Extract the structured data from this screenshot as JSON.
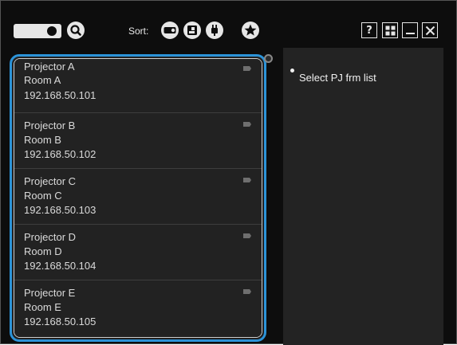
{
  "toolbar": {
    "icons": [
      "projector-icon",
      "search-icon"
    ],
    "sort_label": "Sort:",
    "sort_options": [
      "projector-icon",
      "input-source-icon",
      "power-icon",
      "star-icon"
    ],
    "window_buttons": {
      "help": "?",
      "layout": "grid-icon",
      "minimize": "minimize-icon",
      "close": "close-icon"
    }
  },
  "projectors": [
    {
      "name": "Projector A",
      "room": "Room A",
      "ip": "192.168.50.101"
    },
    {
      "name": "Projector B",
      "room": "Room B",
      "ip": "192.168.50.102"
    },
    {
      "name": "Projector C",
      "room": "Room C",
      "ip": "192.168.50.103"
    },
    {
      "name": "Projector D",
      "room": "Room D",
      "ip": "192.168.50.104"
    },
    {
      "name": "Projector E",
      "room": "Room E",
      "ip": "192.168.50.105"
    }
  ],
  "detail": {
    "message": "Select PJ frm list"
  },
  "colors": {
    "accent": "#2c93d8",
    "background": "#0d0d0d",
    "panel": "#232323",
    "list_item": "#222222"
  }
}
